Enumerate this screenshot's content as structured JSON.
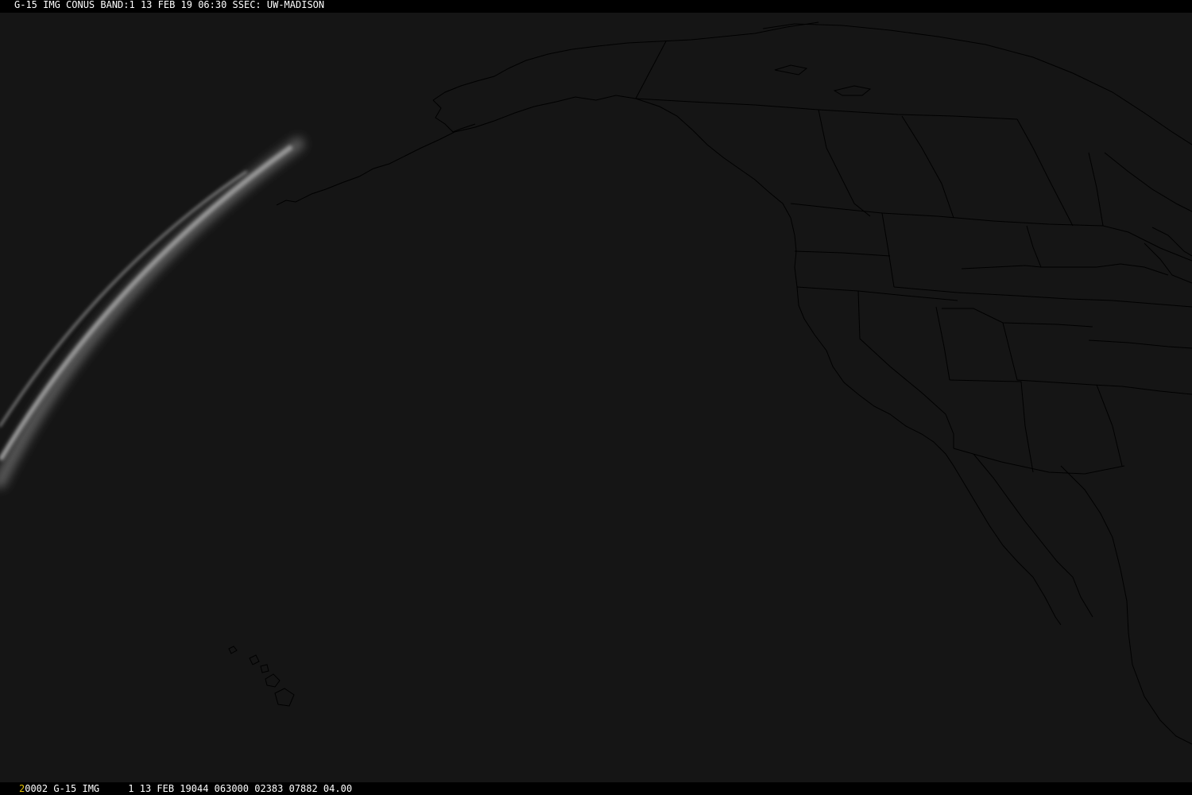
{
  "header": {
    "title": "G-15 IMG CONUS BAND:1 13 FEB 19 06:30 SSEC: UW-MADISON"
  },
  "footer": {
    "frame_number": "2",
    "info": "0002 G-15 IMG     1 13 FEB 19044 063000 02383 07882 04.00"
  },
  "colors": {
    "background": "#000000",
    "imagery": "#151515",
    "map_outline": "#000000",
    "limb_glow": "#9a9a9a",
    "bar_text": "#ffffff",
    "frame_number": "#e6c200"
  },
  "map": {
    "type": "satellite-visible-image",
    "satellite": "G-15",
    "band": "1",
    "overlay": "political-boundaries"
  }
}
